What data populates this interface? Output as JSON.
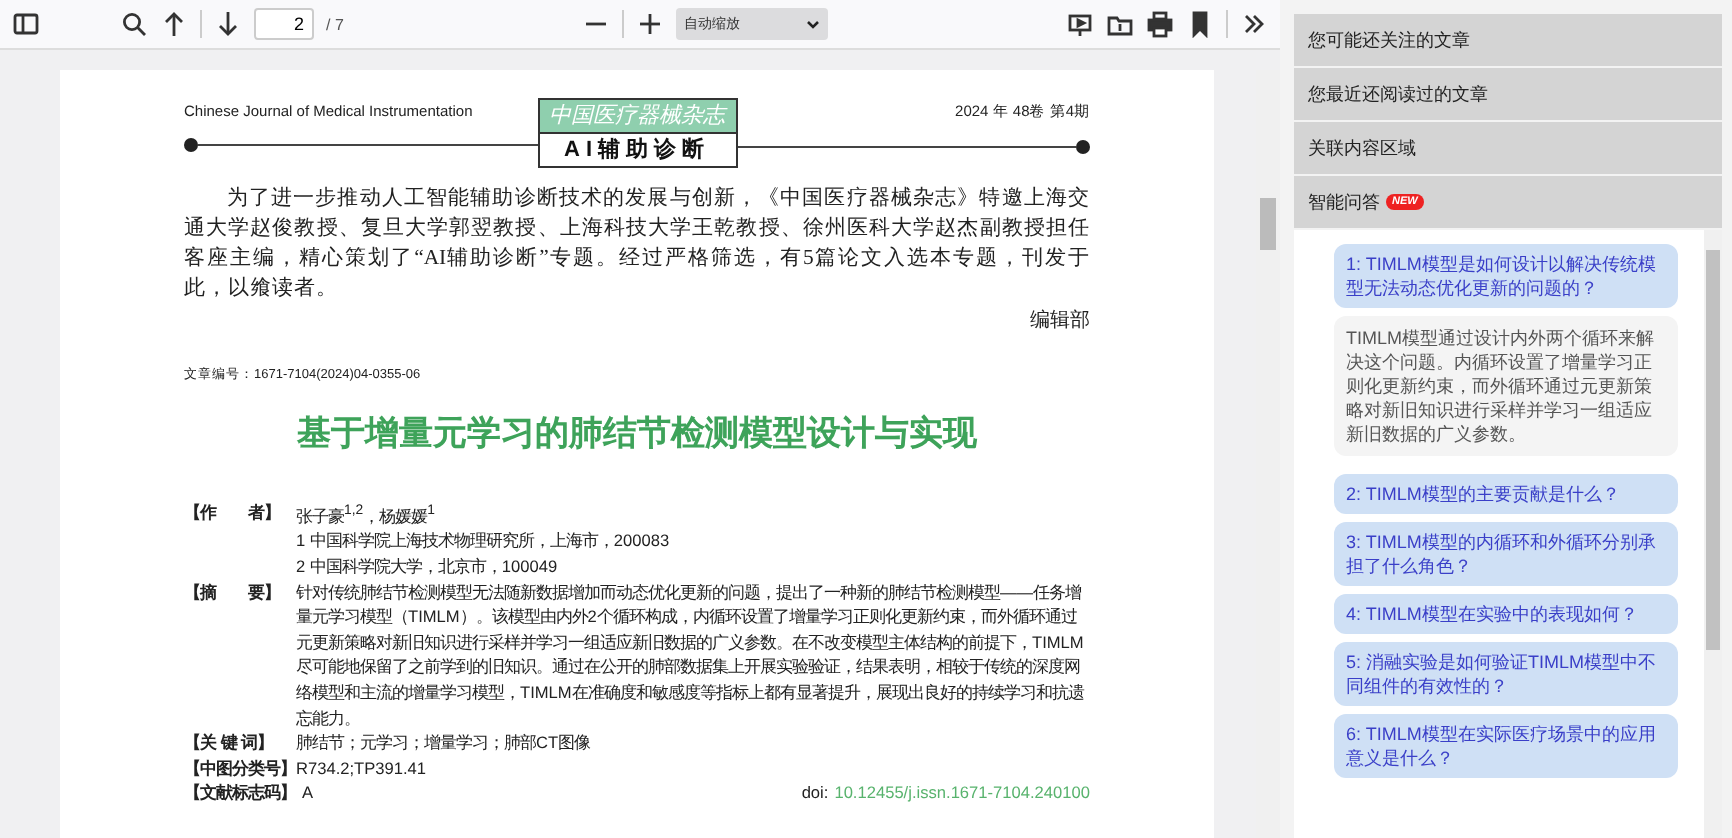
{
  "toolbar": {
    "page_input": "2",
    "page_count": "/ 7",
    "zoom": "自动缩放"
  },
  "document": {
    "journal_name": "Chinese Journal of Medical Instrumentation",
    "issue": "2024 年 48卷 第4期",
    "logo_title": "中国医疗器械杂志",
    "logo_subtitle": "AI辅助诊断",
    "intro": "为了进一步推动人工智能辅助诊断技术的发展与创新，《中国医疗器械杂志》特邀上海交通大学赵俊教授、复旦大学郭翌教授、上海科技大学王乾教授、徐州医科大学赵杰副教授担任客座主编，精心策划了“AI辅助诊断”专题。经过严格筛选，有5篇论文入选本专题，刊发于此，以飨读者。",
    "signature": "编辑部",
    "article_number": "文章编号：1671-7104(2024)04-0355-06",
    "title": "基于增量元学习的肺结节检测模型设计与实现",
    "meta": [
      {
        "label": "【作　　者】",
        "lines": [
          "张子豪$^{1,2}$，杨媛媛$^{1}$",
          "1 中国科学院上海技术物理研究所，上海市，200083",
          "2 中国科学院大学，北京市，100049"
        ]
      },
      {
        "label": "【摘　　要】",
        "lines": [
          "针对传统肺结节检测模型无法随新数据增加而动态优化更新的问题，提出了一种新的肺结节检测模型——任务增量元学习模型（TIMLM）。该模型由内外2个循环构成，内循环设置了增量学习正则化更新约束，而外循环通过元更新策略对新旧知识进行采样并学习一组适应新旧数据的广义参数。在不改变模型主体结构的前提下，TIMLM尽可能地保留了之前学到的旧知识。通过在公开的肺部数据集上开展实验验证，结果表明，相较于传统的深度网络模型和主流的增量学习模型，TIMLM在准确度和敏感度等指标上都有显著提升，展现出良好的持续学习和抗遗忘能力。"
        ]
      },
      {
        "label": "【关 键 词】",
        "lines": [
          "肺结节；元学习；增量学习；肺部CT图像"
        ]
      },
      {
        "label": "【中图分类号】",
        "lines": [
          "R734.2;TP391.41"
        ]
      },
      {
        "label": "【文献标志码】",
        "lines": [
          "A"
        ]
      }
    ],
    "doi_label": "doi:",
    "doi": "10.12455/j.issn.1671-7104.240100"
  },
  "sidebar": {
    "sections": [
      {
        "title": "您可能还关注的文章"
      },
      {
        "title": "您最近还阅读过的文章"
      },
      {
        "title": "关联内容区域"
      },
      {
        "title": "智能问答",
        "badge": "NEW",
        "chat": [
          {
            "kind": "question",
            "text": "1: TIMLM模型是如何设计以解决传统模型无法动态优化更新的问题的？"
          },
          {
            "kind": "answer",
            "text": "TIMLM模型通过设计内外两个循环来解决这个问题。内循环设置了增量学习正则化更新约束，而外循环通过元更新策略对新旧知识进行采样并学习一组适应新旧数据的广义参数。"
          },
          {
            "kind": "question",
            "text": "2: TIMLM模型的主要贡献是什么？"
          },
          {
            "kind": "question",
            "text": "3: TIMLM模型的内循环和外循环分别承担了什么角色？"
          },
          {
            "kind": "question",
            "text": "4: TIMLM模型在实验中的表现如何？"
          },
          {
            "kind": "question",
            "text": "5: 消融实验是如何验证TIMLM模型中不同组件的有效性的？"
          },
          {
            "kind": "question",
            "text": "6: TIMLM模型在实际医疗场景中的应用意义是什么？"
          }
        ]
      }
    ]
  }
}
